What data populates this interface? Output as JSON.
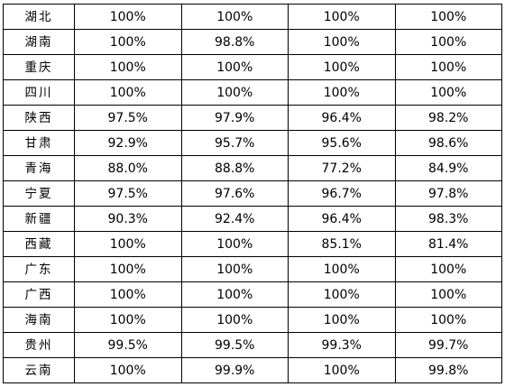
{
  "table": {
    "rows": [
      {
        "region": "湖北",
        "values": [
          "100%",
          "100%",
          "100%",
          "100%"
        ]
      },
      {
        "region": "湖南",
        "values": [
          "100%",
          "98.8%",
          "100%",
          "100%"
        ]
      },
      {
        "region": "重庆",
        "values": [
          "100%",
          "100%",
          "100%",
          "100%"
        ]
      },
      {
        "region": "四川",
        "values": [
          "100%",
          "100%",
          "100%",
          "100%"
        ]
      },
      {
        "region": "陕西",
        "values": [
          "97.5%",
          "97.9%",
          "96.4%",
          "98.2%"
        ]
      },
      {
        "region": "甘肃",
        "values": [
          "92.9%",
          "95.7%",
          "95.6%",
          "98.6%"
        ]
      },
      {
        "region": "青海",
        "values": [
          "88.0%",
          "88.8%",
          "77.2%",
          "84.9%"
        ]
      },
      {
        "region": "宁夏",
        "values": [
          "97.5%",
          "97.6%",
          "96.7%",
          "97.8%"
        ]
      },
      {
        "region": "新疆",
        "values": [
          "90.3%",
          "92.4%",
          "96.4%",
          "98.3%"
        ]
      },
      {
        "region": "西藏",
        "values": [
          "100%",
          "100%",
          "85.1%",
          "81.4%"
        ]
      },
      {
        "region": "广东",
        "values": [
          "100%",
          "100%",
          "100%",
          "100%"
        ]
      },
      {
        "region": "广西",
        "values": [
          "100%",
          "100%",
          "100%",
          "100%"
        ]
      },
      {
        "region": "海南",
        "values": [
          "100%",
          "100%",
          "100%",
          "100%"
        ]
      },
      {
        "region": "贵州",
        "values": [
          "99.5%",
          "99.5%",
          "99.3%",
          "99.7%"
        ]
      },
      {
        "region": "云南",
        "values": [
          "100%",
          "99.9%",
          "100%",
          "99.8%"
        ]
      }
    ]
  },
  "colors": {
    "border": "#000000",
    "background": "#ffffff",
    "text": "#000000"
  }
}
